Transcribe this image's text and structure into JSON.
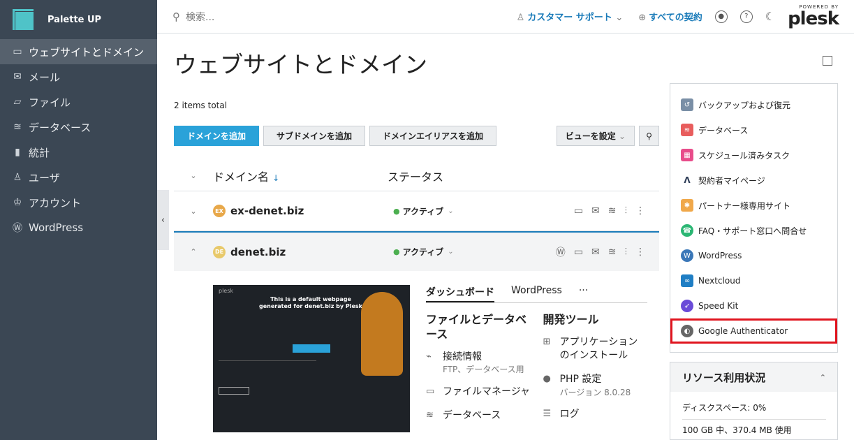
{
  "brand": {
    "name": "Palette UP"
  },
  "sidebar": {
    "items": [
      {
        "label": "ウェブサイトとドメイン",
        "icon": "monitor-icon"
      },
      {
        "label": "メール",
        "icon": "mail-icon"
      },
      {
        "label": "ファイル",
        "icon": "folder-icon"
      },
      {
        "label": "データベース",
        "icon": "database-icon"
      },
      {
        "label": "統計",
        "icon": "chart-icon"
      },
      {
        "label": "ユーザ",
        "icon": "user-icon"
      },
      {
        "label": "アカウント",
        "icon": "crown-icon"
      },
      {
        "label": "WordPress",
        "icon": "wordpress-icon"
      }
    ]
  },
  "topbar": {
    "search_placeholder": "検索...",
    "customer_label": "カスタマー",
    "support_label": "サポート",
    "subscriptions_label": "すべての契約",
    "powered_by": "POWERED BY",
    "plesk": "plesk"
  },
  "page": {
    "title": "ウェブサイトとドメイン",
    "total": "2 items total"
  },
  "toolbar": {
    "add_domain": "ドメインを追加",
    "add_subdomain": "サブドメインを追加",
    "add_alias": "ドメインエイリアスを追加",
    "view_settings": "ビューを設定"
  },
  "list": {
    "col_name": "ドメイン名",
    "col_status": "ステータス",
    "rows": [
      {
        "badge": "EX",
        "domain": "ex-denet.biz",
        "status": "アクティブ"
      },
      {
        "badge": "DE",
        "domain": "denet.biz",
        "status": "アクティブ"
      }
    ]
  },
  "detail": {
    "preview_title": "plesk",
    "preview_heading": "This is a default webpage generated for denet.biz by Plesk",
    "tab_dashboard": "ダッシュボード",
    "tab_wordpress": "WordPress",
    "tab_more": "···",
    "files_heading": "ファイルとデータベース",
    "dev_heading": "開発ツール",
    "connection_info": "接続情報",
    "connection_sub": "FTP、データベース用",
    "file_manager": "ファイルマネージャ",
    "database": "データベース",
    "app_install": "アプリケーションのインストール",
    "php_settings": "PHP 設定",
    "php_version": "バージョン 8.0.28",
    "logs": "ログ"
  },
  "right_panel": {
    "items": [
      {
        "label": "バックアップおよび復元",
        "color": "#7a8fa6"
      },
      {
        "label": "データベース",
        "color": "#e85d5d"
      },
      {
        "label": "スケジュール済みタスク",
        "color": "#e84c8a"
      },
      {
        "label": "契約者マイページ",
        "color": "#2b3a55"
      },
      {
        "label": "パートナー様専用サイト",
        "color": "#f0a84a"
      },
      {
        "label": "FAQ・サポート窓口へ問合せ",
        "color": "#2bb673"
      },
      {
        "label": "WordPress",
        "color": "#3a77b8"
      },
      {
        "label": "Nextcloud",
        "color": "#1f7ec4"
      },
      {
        "label": "Speed Kit",
        "color": "#6a4bd8"
      },
      {
        "label": "Google Authenticator",
        "color": "#666666"
      }
    ]
  },
  "resource": {
    "title": "リソース利用状況",
    "disk": "ディスクスペース: 0%",
    "usage": "100 GB 中、370.4 MB 使用"
  }
}
